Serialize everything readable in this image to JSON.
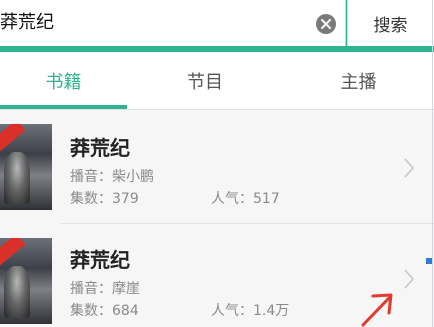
{
  "search": {
    "query": "莽荒纪",
    "button_label": "搜索"
  },
  "tabs": [
    {
      "label": "书籍",
      "active": true
    },
    {
      "label": "节目",
      "active": false
    },
    {
      "label": "主播",
      "active": false
    }
  ],
  "results": [
    {
      "title": "莽荒纪",
      "narrator": "播音：柴小鹏",
      "episodes": "集数：379",
      "popularity": "人气：517"
    },
    {
      "title": "莽荒纪",
      "narrator": "播音：摩崖",
      "episodes": "集数：684",
      "popularity": "人气：1.4万"
    }
  ],
  "colors": {
    "accent": "#2fb28f",
    "annotation": "#e23a2e"
  },
  "icons": {
    "clear": "clear-icon",
    "chevron": "chevron-right-icon",
    "annotation": "red-arrow-annotation"
  }
}
